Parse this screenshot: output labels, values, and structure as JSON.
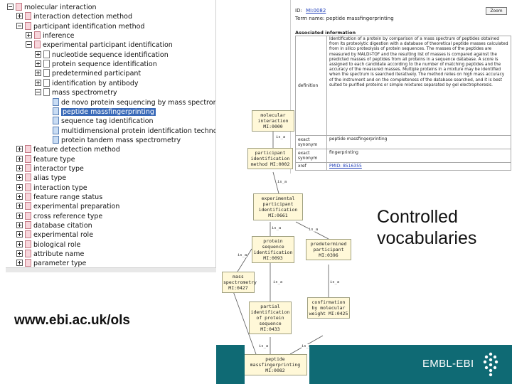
{
  "tree": {
    "items": [
      {
        "label": "molecular interaction",
        "depth": 0,
        "expander": "minus",
        "icon": "pink"
      },
      {
        "label": "interaction detection method",
        "depth": 1,
        "expander": "plus",
        "icon": "pink"
      },
      {
        "label": "participant identification method",
        "depth": 1,
        "expander": "minus",
        "icon": "pink"
      },
      {
        "label": "inference",
        "depth": 2,
        "expander": "plus",
        "icon": "pink"
      },
      {
        "label": "experimental participant identification",
        "depth": 2,
        "expander": "minus",
        "icon": "pink"
      },
      {
        "label": "nucleotide sequence identification",
        "depth": 3,
        "expander": "plus",
        "icon": "plain"
      },
      {
        "label": "protein sequence identification",
        "depth": 3,
        "expander": "plus",
        "icon": "plain"
      },
      {
        "label": "predetermined participant",
        "depth": 3,
        "expander": "plus",
        "icon": "plain"
      },
      {
        "label": "identification by antibody",
        "depth": 3,
        "expander": "plus",
        "icon": "plain"
      },
      {
        "label": "mass spectrometry",
        "depth": 3,
        "expander": "minus",
        "icon": "plain"
      },
      {
        "label": "de novo protein sequencing by mass spectrometry",
        "depth": 4,
        "expander": "none",
        "icon": "blue"
      },
      {
        "label": "peptide massfingerprinting",
        "depth": 4,
        "expander": "none",
        "icon": "blue",
        "selected": true
      },
      {
        "label": "sequence tag identification",
        "depth": 4,
        "expander": "none",
        "icon": "blue"
      },
      {
        "label": "multidimensional protein identification technology",
        "depth": 4,
        "expander": "none",
        "icon": "blue"
      },
      {
        "label": "protein tandem mass spectrometry",
        "depth": 4,
        "expander": "none",
        "icon": "blue"
      },
      {
        "label": "feature detection method",
        "depth": 1,
        "expander": "plus",
        "icon": "pink"
      },
      {
        "label": "feature type",
        "depth": 1,
        "expander": "plus",
        "icon": "pink"
      },
      {
        "label": "interactor type",
        "depth": 1,
        "expander": "plus",
        "icon": "pink"
      },
      {
        "label": "alias type",
        "depth": 1,
        "expander": "plus",
        "icon": "pink"
      },
      {
        "label": "interaction type",
        "depth": 1,
        "expander": "plus",
        "icon": "pink"
      },
      {
        "label": "feature range status",
        "depth": 1,
        "expander": "plus",
        "icon": "pink"
      },
      {
        "label": "experimental preparation",
        "depth": 1,
        "expander": "plus",
        "icon": "pink"
      },
      {
        "label": "cross reference type",
        "depth": 1,
        "expander": "plus",
        "icon": "pink"
      },
      {
        "label": "database citation",
        "depth": 1,
        "expander": "plus",
        "icon": "pink"
      },
      {
        "label": "experimental role",
        "depth": 1,
        "expander": "plus",
        "icon": "pink"
      },
      {
        "label": "biological role",
        "depth": 1,
        "expander": "plus",
        "icon": "pink"
      },
      {
        "label": "attribute name",
        "depth": 1,
        "expander": "plus",
        "icon": "pink"
      },
      {
        "label": "parameter type",
        "depth": 1,
        "expander": "plus",
        "icon": "pink"
      }
    ]
  },
  "detail": {
    "id_label": "ID:",
    "id_value": "MI:0082",
    "term_name": "Term name: peptide massfingerprinting",
    "zoom_label": "Zoom",
    "section_title": "Associated information",
    "rows": [
      {
        "key": "definition",
        "value": "Identification of a protein by comparison of a mass spectrum of peptides obtained from its proteolytic digestion with a database of theoretical peptide masses calculated from in silico proteolysis of protein sequences. The masses of the peptides are measured by MALDI-TOF and the resulting list of masses is compared against the predicted masses of peptides from all proteins in a sequence database. A score is assigned to each candidate according to the number of matching peptides and the accuracy of the measured masses. Multiple proteins in a mixture may be identified when the spectrum is searched iteratively. The method relies on high mass accuracy of the instrument and on the completeness of the database searched, and it is best suited to purified proteins or simple mixtures separated by gel electrophoresis."
      },
      {
        "key": "exact synonym",
        "value": "peptide massfingerprinting"
      },
      {
        "key": "exact synonym",
        "value": "fingerprinting"
      },
      {
        "key": "xref",
        "value": "PMID: 8516355"
      }
    ]
  },
  "graph": {
    "nodes": [
      {
        "id": "mi0000",
        "label": "molecular interaction MI:0000"
      },
      {
        "id": "mi0002",
        "label": "participant identification method MI:0002"
      },
      {
        "id": "mi0661",
        "label": "experimental participant identification MI:0661"
      },
      {
        "id": "mi0093",
        "label": "protein sequence identification MI:0093"
      },
      {
        "id": "mi0396",
        "label": "predetermined participant MI:0396"
      },
      {
        "id": "mi0427",
        "label": "mass spectrometry MI:0427"
      },
      {
        "id": "mi0433",
        "label": "partial identification of protein sequence MI:0433"
      },
      {
        "id": "mi0425",
        "label": "confirmation by molecular weight MI:0425"
      },
      {
        "id": "mi0082",
        "label": "peptide massfingerprinting MI:0082"
      }
    ],
    "edge_label": "is_a"
  },
  "caption": {
    "line1": "Controlled",
    "line2": "vocabularies"
  },
  "url": "www.ebi.ac.uk/ols",
  "footer": {
    "logo_text": "EMBL-EBI",
    "color": "#0f6a74"
  },
  "icons": {
    "expander": "tree-expander-icon",
    "document": "document-icon",
    "logo": "embl-ebi-logo-icon"
  }
}
